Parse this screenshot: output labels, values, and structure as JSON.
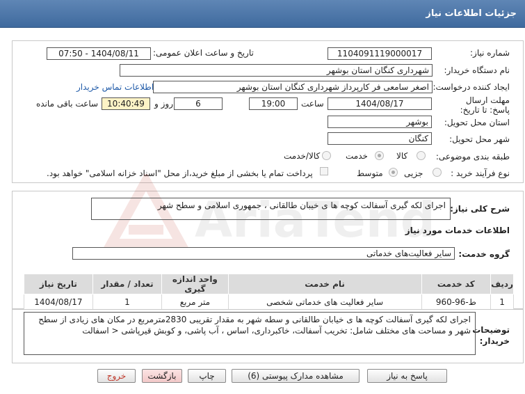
{
  "header": {
    "title": "جزئیات اطلاعات نیاز"
  },
  "fields": {
    "need_number_label": "شماره نیاز:",
    "need_number": "1104091119000017",
    "announce_label": "تاریخ و ساعت اعلان عمومی:",
    "announce_value": "1404/08/11 - 07:50",
    "buyer_org_label": "نام دستگاه خریدار:",
    "buyer_org": "شهرداری کنگان استان بوشهر",
    "creator_label": "ایجاد کننده درخواست:",
    "creator": "اصغر سامعی فر کارپرداز شهرداری کنگان استان بوشهر",
    "contact_link": "اطلاعات تماس خریدار",
    "deadline_label": "مهلت ارسال پاسخ: تا تاریخ:",
    "deadline_date": "1404/08/17",
    "time_label": "ساعت",
    "deadline_time": "19:00",
    "days_value": "6",
    "days_label": "روز و",
    "remaining_time": "10:40:49",
    "remaining_label": "ساعت باقی مانده",
    "province_label": "استان محل تحویل:",
    "province": "بوشهر",
    "city_label": "شهر محل تحویل:",
    "city": "کنگان",
    "category_label": "طبقه بندی موضوعی:",
    "category_options": [
      "کالا",
      "خدمت",
      "کالا/خدمت"
    ],
    "process_label": "نوع فرآیند خرید :",
    "process_options": [
      "جزیی",
      "متوسط"
    ],
    "payment_note": "پرداخت تمام یا بخشی از مبلغ خرید،از محل \"اسناد خزانه اسلامی\" خواهد بود."
  },
  "summary": {
    "label": "شرح کلی نیاز:",
    "text": "اجرای لکه گیری آسفالت کوچه ها ی خیبان طالقانی ، جمهوری اسلامی و سطح شهر"
  },
  "services": {
    "section_title": "اطلاعات خدمات مورد نیاز",
    "group_label": "گروه خدمت:",
    "group_value": "سایر فعالیت‌های خدماتی",
    "columns": [
      "ردیف",
      "کد خدمت",
      "نام خدمت",
      "واحد اندازه گیری",
      "تعداد / مقدار",
      "تاریخ نیاز"
    ],
    "rows": [
      [
        "1",
        "ط-96-960",
        "سایر فعالیت های خدماتی شخصی",
        "متر مربع",
        "1",
        "1404/08/17"
      ]
    ]
  },
  "buyer_notes": {
    "label": "توضیحات خریدار:",
    "text": "اجرای لکه گیری آسفالت کوچه ها ی خیابان طالقانی و سطه شهر به مقدار تقریبی 2830مترمربع در مکان های زیادی از سطح شهر و مساحت های مختلف شامل: تخریب آسفالت، خاکبرداری، اساس ، آب پاشی، و کوبش قیرپاشی < اسفالت"
  },
  "buttons": {
    "reply": "پاسخ به نیاز",
    "attachments": "مشاهده مدارک پیوستی (6)",
    "print": "چاپ",
    "back": "بازگشت",
    "exit": "خروج"
  },
  "watermark": {
    "text": "AriaTender.net"
  },
  "colors": {
    "header": "#4a76aa",
    "highlight": "#fdf3c6",
    "exit": "#c0392b"
  }
}
